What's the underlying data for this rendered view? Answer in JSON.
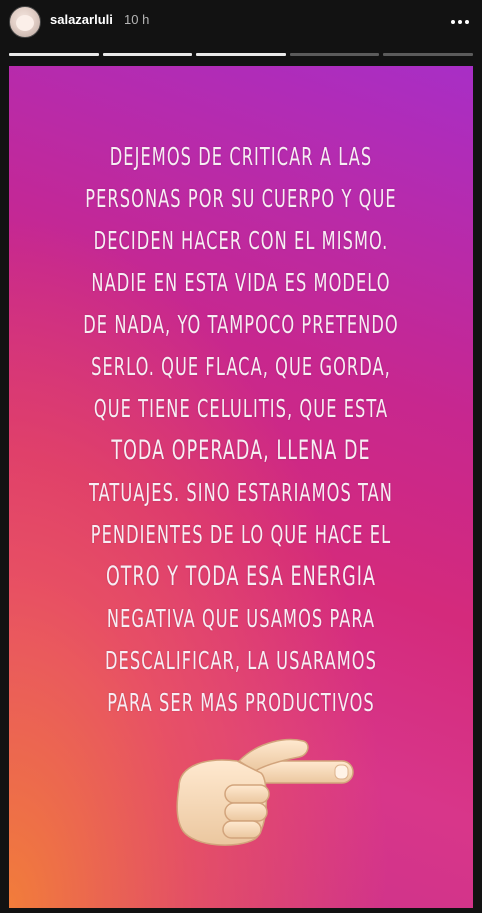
{
  "header": {
    "username": "salazarluli",
    "time": "10 h",
    "more_icon": "more-horizontal-icon",
    "avatar_icon": "profile-avatar"
  },
  "progress": {
    "segments": 5,
    "completed": 3
  },
  "story": {
    "lines": [
      "DEJEMOS DE CRITICAR A LAS",
      "PERSONAS POR SU CUERPO Y QUE",
      "DECIDEN HACER CON EL MISMO.",
      "NADIE EN ESTA VIDA ES MODELO",
      "DE NADA, YO TAMPOCO PRETENDO",
      "SERLO. QUE FLACA, QUE GORDA,",
      "QUE TIENE CELULITIS, QUE ESTA",
      "TODA OPERADA, LLENA DE",
      "TATUAJES. SINO ESTARIAMOS TAN",
      "PENDIENTES DE LO QUE HACE EL",
      "OTRO Y TODA ESA ENERGIA",
      "NEGATIVA QUE USAMOS PARA",
      "DESCALIFICAR, LA USARAMOS",
      "PARA SER MAS PRODUCTIVOS"
    ],
    "sticker_icon": "pointing-right-hand-emoji",
    "colors": {
      "top": "#a82ec6",
      "middle": "#d42a7c",
      "bottom_left": "#f48136"
    }
  }
}
